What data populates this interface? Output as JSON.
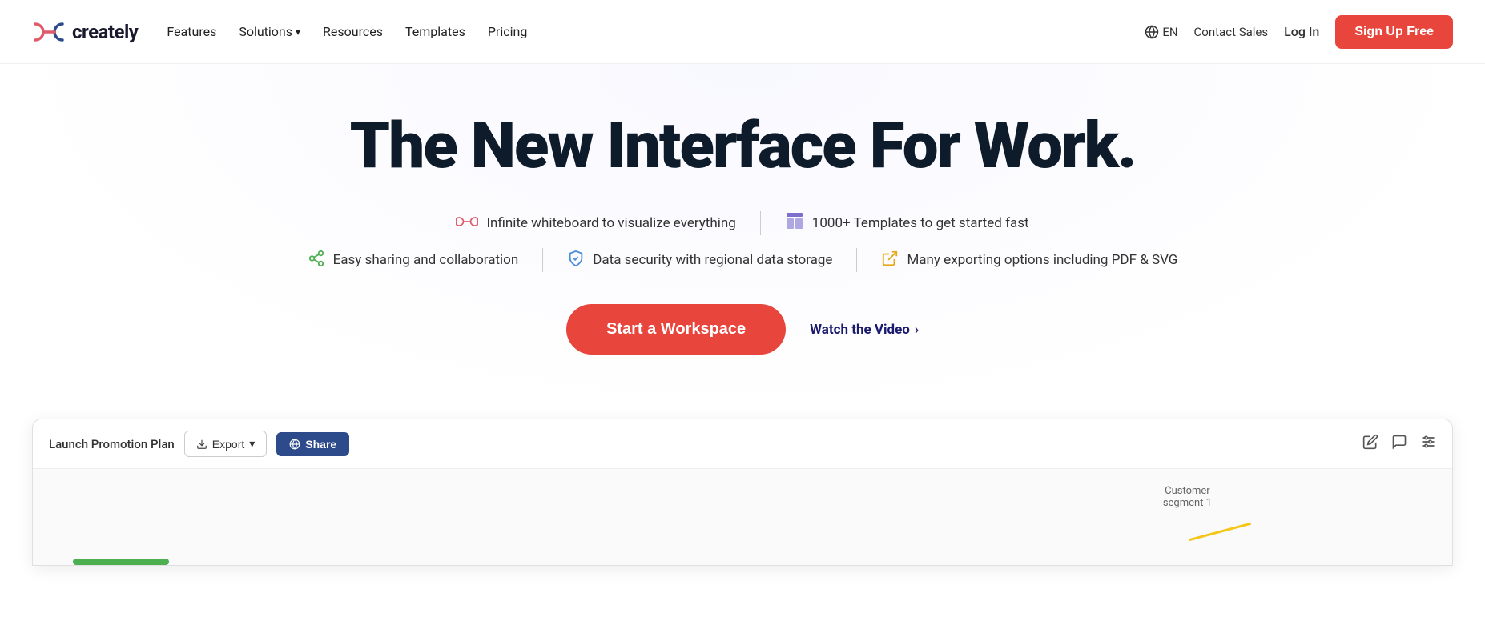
{
  "nav": {
    "logo_text": "creately",
    "links": [
      {
        "label": "Features",
        "has_dropdown": false
      },
      {
        "label": "Solutions",
        "has_dropdown": true
      },
      {
        "label": "Resources",
        "has_dropdown": false
      },
      {
        "label": "Templates",
        "has_dropdown": false
      },
      {
        "label": "Pricing",
        "has_dropdown": false
      }
    ],
    "lang": "EN",
    "contact_sales": "Contact Sales",
    "login": "Log In",
    "signup": "Sign Up Free"
  },
  "hero": {
    "title": "The New Interface For Work.",
    "features": [
      {
        "icon": "infinite",
        "text": "Infinite whiteboard to visualize everything"
      },
      {
        "icon": "template",
        "text": "1000+ Templates to get started fast"
      },
      {
        "icon": "share",
        "text": "Easy sharing and collaboration"
      },
      {
        "icon": "shield",
        "text": "Data security with regional data storage"
      },
      {
        "icon": "export",
        "text": "Many exporting options including PDF & SVG"
      }
    ],
    "cta_primary": "Start a Workspace",
    "cta_secondary": "Watch the Video"
  },
  "preview": {
    "doc_title": "Launch Promotion Plan",
    "export_btn": "Export",
    "share_btn": "Share",
    "customer_label": "Customer\nsegment 1"
  }
}
